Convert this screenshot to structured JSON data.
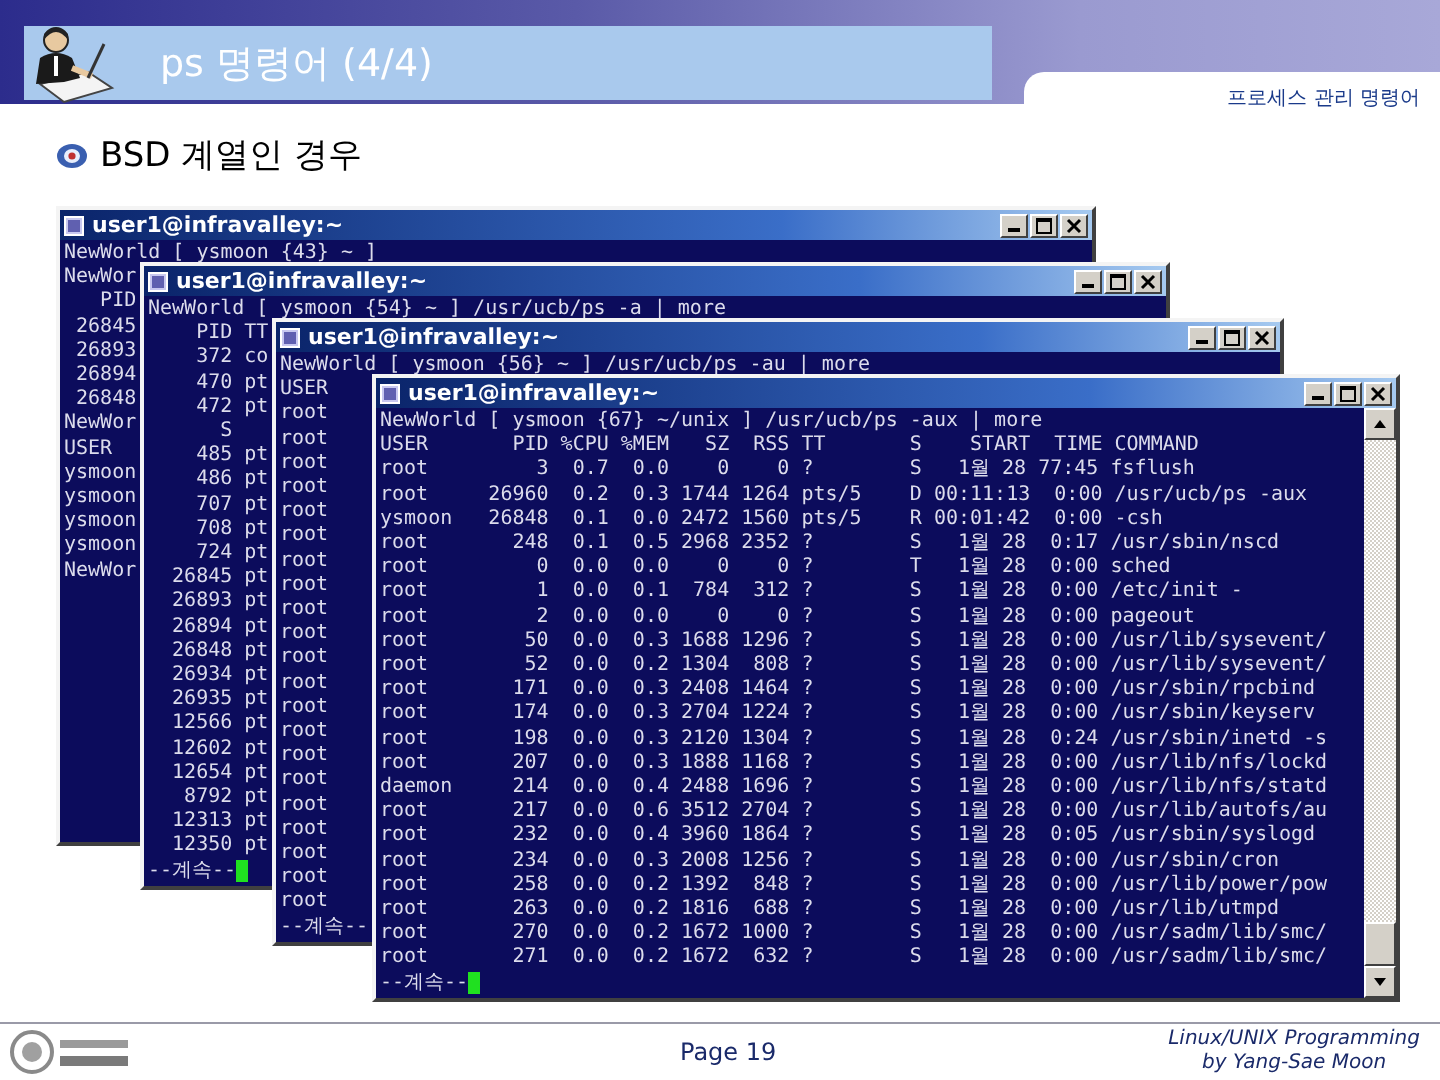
{
  "slide": {
    "title": "ps 명령어 (4/4)",
    "section": "프로세스 관리 명령어",
    "bullet": "BSD 계열인 경우"
  },
  "windows": [
    {
      "title": "user1@infravalley:~",
      "lines": [
        "NewWorld [ ysmoon {43} ~ ]",
        "NewWor",
        "   PID",
        " 26845",
        " 26893",
        " 26894",
        " 26848",
        "NewWor",
        "USER",
        "ysmoon",
        "ysmoon",
        "ysmoon",
        "ysmoon",
        "NewWor"
      ]
    },
    {
      "title": "user1@infravalley:~",
      "prompt": "--계속--",
      "lines": [
        "NewWorld [ ysmoon {54} ~ ] /usr/ucb/ps -a | more",
        "    PID TT",
        "    372 co",
        "    470 pt",
        "    472 pt",
        "      S",
        "    485 pt",
        "    486 pt",
        "    707 pt",
        "    708 pt",
        "    724 pt",
        "  26845 pt",
        "  26893 pt",
        "  26894 pt",
        "  26848 pt",
        "  26934 pt",
        "  26935 pt",
        "  12566 pt",
        "  12602 pt",
        "  12654 pt",
        "   8792 pt",
        "  12313 pt",
        "  12350 pt"
      ]
    },
    {
      "title": "user1@infravalley:~",
      "prompt": "--계속--",
      "lines": [
        "NewWorld [ ysmoon {56} ~ ] /usr/ucb/ps -au | more",
        "USER",
        "root",
        "root",
        "root",
        "root",
        "root",
        "root",
        "root",
        "root",
        "root",
        "root",
        "root",
        "root",
        "root",
        "root",
        "root",
        "root",
        "root",
        "root",
        "root",
        "root",
        "root"
      ]
    },
    {
      "title": "user1@infravalley:~",
      "prompt": "--계속--",
      "lines": [
        "NewWorld [ ysmoon {67} ~/unix ] /usr/ucb/ps -aux | more",
        "USER       PID %CPU %MEM   SZ  RSS TT       S    START  TIME COMMAND",
        "root         3  0.7  0.0    0    0 ?        S   1월 28 77:45 fsflush",
        "root     26960  0.2  0.3 1744 1264 pts/5    D 00:11:13  0:00 /usr/ucb/ps -aux",
        "ysmoon   26848  0.1  0.0 2472 1560 pts/5    R 00:01:42  0:00 -csh",
        "root       248  0.1  0.5 2968 2352 ?        S   1월 28  0:17 /usr/sbin/nscd",
        "root         0  0.0  0.0    0    0 ?        T   1월 28  0:00 sched",
        "root         1  0.0  0.1  784  312 ?        S   1월 28  0:00 /etc/init -",
        "root         2  0.0  0.0    0    0 ?        S   1월 28  0:00 pageout",
        "root        50  0.0  0.3 1688 1296 ?        S   1월 28  0:00 /usr/lib/sysevent/",
        "root        52  0.0  0.2 1304  808 ?        S   1월 28  0:00 /usr/lib/sysevent/",
        "root       171  0.0  0.3 2408 1464 ?        S   1월 28  0:00 /usr/sbin/rpcbind",
        "root       174  0.0  0.3 2704 1224 ?        S   1월 28  0:00 /usr/sbin/keyserv",
        "root       198  0.0  0.3 2120 1304 ?        S   1월 28  0:24 /usr/sbin/inetd -s",
        "root       207  0.0  0.3 1888 1168 ?        S   1월 28  0:00 /usr/lib/nfs/lockd",
        "daemon     214  0.0  0.4 2488 1696 ?        S   1월 28  0:00 /usr/lib/nfs/statd",
        "root       217  0.0  0.6 3512 2704 ?        S   1월 28  0:00 /usr/lib/autofs/au",
        "root       232  0.0  0.4 3960 1864 ?        S   1월 28  0:05 /usr/sbin/syslogd",
        "root       234  0.0  0.3 2008 1256 ?        S   1월 28  0:00 /usr/sbin/cron",
        "root       258  0.0  0.2 1392  848 ?        S   1월 28  0:00 /usr/lib/power/pow",
        "root       263  0.0  0.2 1816  688 ?        S   1월 28  0:00 /usr/lib/utmpd",
        "root       270  0.0  0.2 1672 1000 ?        S   1월 28  0:00 /usr/sadm/lib/smc/",
        "root       271  0.0  0.2 1672  632 ?        S   1월 28  0:00 /usr/sadm/lib/smc/"
      ]
    }
  ],
  "footer": {
    "page": "Page 19",
    "credit": [
      "Linux/UNIX Programming",
      "by Yang-Sae Moon"
    ]
  }
}
